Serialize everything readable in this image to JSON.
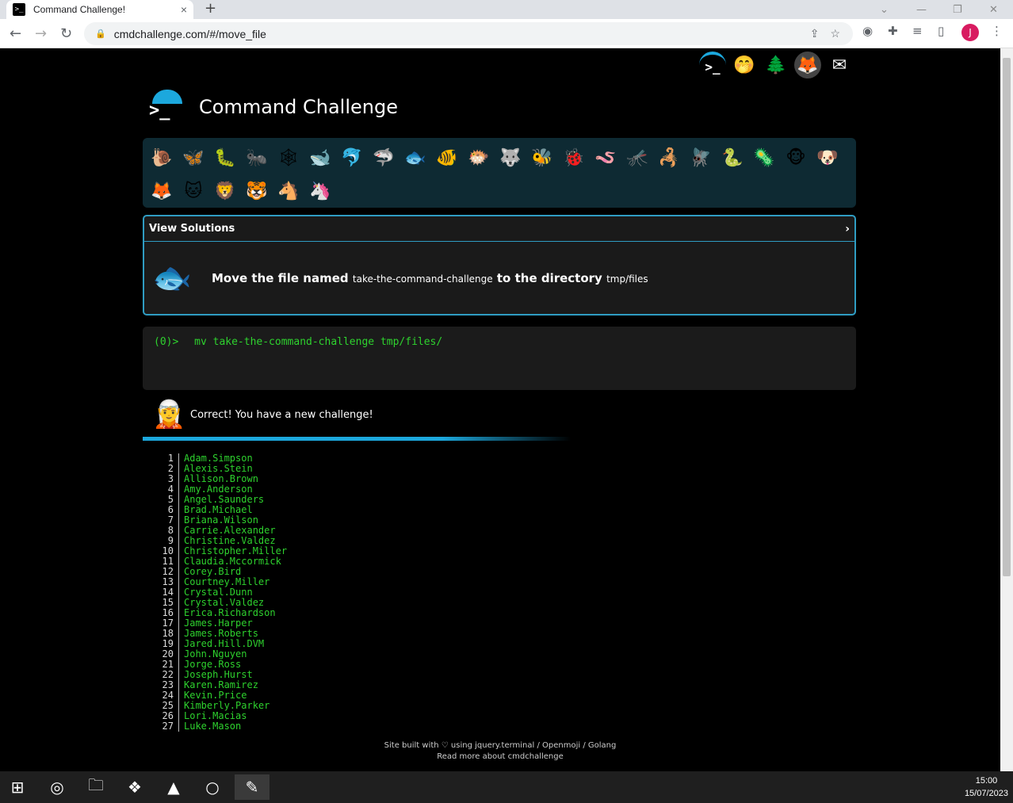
{
  "browser": {
    "tab_title": "Command Challenge!",
    "tab_favicon": ">_",
    "tab_close": "×",
    "new_tab": "+",
    "url": "cmdchallenge.com/#/move_file",
    "avatar_letter": "J"
  },
  "header": {
    "title": "Command Challenge"
  },
  "top_icons": [
    "terminal-icon",
    "face-with-hand-over-mouth-icon",
    "tree-icon",
    "gitlab-icon",
    "envelope-icon"
  ],
  "levels": [
    {
      "name": "snail-icon",
      "glyph": "🐌"
    },
    {
      "name": "butterfly-icon",
      "glyph": "🦋"
    },
    {
      "name": "caterpillar-icon",
      "glyph": "🐛"
    },
    {
      "name": "ant-icon",
      "glyph": "🐜"
    },
    {
      "name": "spider-web-icon",
      "glyph": "🕸"
    },
    {
      "name": "whale-icon",
      "glyph": "🐋"
    },
    {
      "name": "dolphin-icon",
      "glyph": "🐬"
    },
    {
      "name": "shark-icon",
      "glyph": "🦈"
    },
    {
      "name": "fish-icon",
      "glyph": "🐟"
    },
    {
      "name": "tropical-fish-icon",
      "glyph": "🐠"
    },
    {
      "name": "blowfish-icon",
      "glyph": "🐡"
    },
    {
      "name": "wolf-icon",
      "glyph": "🐺"
    },
    {
      "name": "bee-icon",
      "glyph": "🐝"
    },
    {
      "name": "lady-beetle-icon",
      "glyph": "🐞"
    },
    {
      "name": "worm-icon",
      "glyph": "🪱"
    },
    {
      "name": "mosquito-icon",
      "glyph": "🦟"
    },
    {
      "name": "scorpion-icon",
      "glyph": "🦂"
    },
    {
      "name": "fly-icon",
      "glyph": "🪰"
    },
    {
      "name": "snake-icon",
      "glyph": "🐍"
    },
    {
      "name": "microbe-icon",
      "glyph": "🦠"
    },
    {
      "name": "monkey-icon",
      "glyph": "🐵"
    },
    {
      "name": "dog-icon",
      "glyph": "🐶"
    },
    {
      "name": "fox-icon",
      "glyph": "🦊"
    },
    {
      "name": "cat-icon",
      "glyph": "🐱"
    },
    {
      "name": "lion-icon",
      "glyph": "🦁"
    },
    {
      "name": "tiger-icon",
      "glyph": "🐯"
    },
    {
      "name": "horse-icon",
      "glyph": "🐴"
    },
    {
      "name": "unicorn-icon",
      "glyph": "🦄"
    }
  ],
  "challenge": {
    "view_solutions": "View Solutions",
    "chevron": "›",
    "fish_glyph": "🐟",
    "text_before": "Move the file named",
    "file_name": "take-the-command-challenge",
    "text_middle": "to the directory",
    "dir_name": "tmp/files"
  },
  "terminal": {
    "prompt": "(0)>",
    "command": "mv take-the-command-challenge tmp/files/"
  },
  "result": {
    "glyph": "🧝",
    "message": "Correct! You have a new challenge!"
  },
  "output": [
    "Adam.Simpson",
    "Alexis.Stein",
    "Allison.Brown",
    "Amy.Anderson",
    "Angel.Saunders",
    "Brad.Michael",
    "Briana.Wilson",
    "Carrie.Alexander",
    "Christine.Valdez",
    "Christopher.Miller",
    "Claudia.Mccormick",
    "Corey.Bird",
    "Courtney.Miller",
    "Crystal.Dunn",
    "Crystal.Valdez",
    "Erica.Richardson",
    "James.Harper",
    "James.Roberts",
    "Jared.Hill.DVM",
    "John.Nguyen",
    "Jorge.Ross",
    "Joseph.Hurst",
    "Karen.Ramirez",
    "Kevin.Price",
    "Kimberly.Parker",
    "Lori.Macias",
    "Luke.Mason"
  ],
  "footer": {
    "line1": "Site built with ♡ using jquery.terminal / Openmoji / Golang",
    "line2": "Read more about cmdchallenge"
  },
  "taskbar": {
    "time": "15:00",
    "date": "15/07/2023"
  },
  "colors": {
    "accent": "#1ca8dd",
    "terminal_green": "#2ed22e",
    "levels_bg": "#0e2a33"
  }
}
